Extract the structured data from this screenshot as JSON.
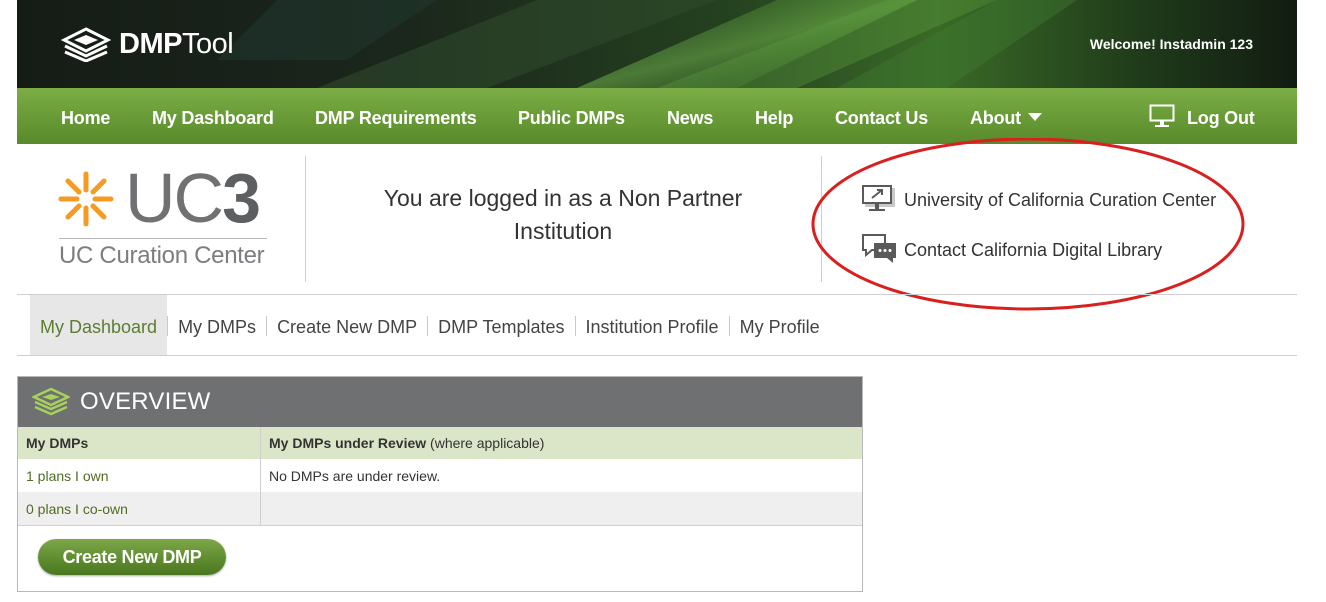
{
  "brand": {
    "bold": "DMP",
    "thin": "Tool"
  },
  "welcome": {
    "prefix": "Welcome!",
    "user": "Instadmin 123"
  },
  "nav": {
    "home": "Home",
    "dashboard": "My Dashboard",
    "requirements": "DMP Requirements",
    "public": "Public DMPs",
    "news": "News",
    "help": "Help",
    "contact": "Contact Us",
    "about": "About",
    "logout": "Log Out"
  },
  "institution": {
    "logo_main": "UC",
    "logo_bold": "3",
    "logo_sub": "UC Curation Center",
    "status_line1": "You are logged in as a Non Partner",
    "status_line2": "Institution",
    "links": {
      "curation": "University of California Curation Center",
      "cdl": "Contact California Digital Library"
    }
  },
  "subnav": {
    "tabs": [
      "My Dashboard",
      "My DMPs",
      "Create New DMP",
      "DMP Templates",
      "Institution Profile",
      "My Profile"
    ],
    "active": "My Dashboard"
  },
  "overview": {
    "title": "OVERVIEW",
    "col1": "My DMPs",
    "col2_bold": "My DMPs under Review",
    "col2_note": "(where applicable)",
    "rows": [
      [
        "1 plans I own",
        "No DMPs are under review."
      ],
      [
        "0 plans I co-own",
        ""
      ]
    ],
    "button": "Create New DMP"
  },
  "colors": {
    "nav_green": "#679a36",
    "panel_grey": "#6f7071",
    "highlight_oval": "#d9201e",
    "table_header": "#dbe6c9",
    "uc3_orange": "#f59a23"
  },
  "icons": [
    "dmptool-logo-icon",
    "monitor-icon",
    "caret-down-icon",
    "uc3-starburst-icon",
    "presentation-icon",
    "chat-icon",
    "layers-icon"
  ]
}
